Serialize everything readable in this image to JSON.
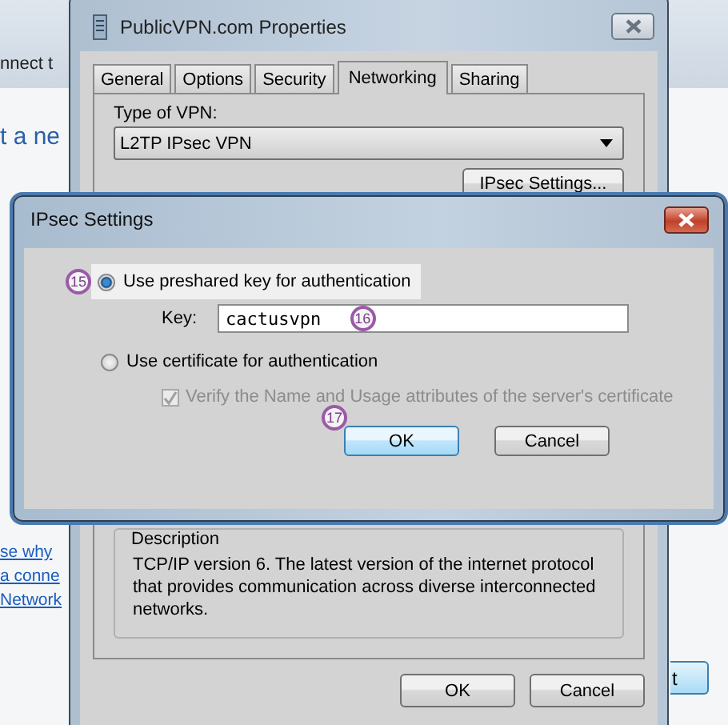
{
  "background_window": {
    "heading_fragment": "nnect t",
    "title_fragment": "t a ne",
    "links": [
      "se why",
      "a conne",
      "Network"
    ],
    "button_fragment": "t"
  },
  "properties_window": {
    "title": "PublicVPN.com Properties",
    "tabs": [
      {
        "label": "General",
        "selected": false
      },
      {
        "label": "Options",
        "selected": false
      },
      {
        "label": "Security",
        "selected": false
      },
      {
        "label": "Networking",
        "selected": true
      },
      {
        "label": "Sharing",
        "selected": false
      }
    ],
    "vpn_type_label": "Type of VPN:",
    "vpn_type_value": "L2TP IPsec VPN",
    "ipsec_button": "IPsec Settings...",
    "description": {
      "legend": "Description",
      "text": "TCP/IP version 6. The latest version of the internet protocol that provides communication across diverse interconnected networks."
    },
    "buttons": [
      "OK",
      "Cancel"
    ]
  },
  "ipsec_dialog": {
    "title": "IPsec Settings",
    "options": [
      {
        "label": "Use preshared key for authentication",
        "selected": true,
        "badge": "15"
      },
      {
        "label": "Use certificate for authentication",
        "selected": false
      }
    ],
    "key_label": "Key:",
    "key_value": "cactusvpn",
    "key_badge": "16",
    "verify": {
      "label": "Verify the Name and Usage attributes of the server's certificate",
      "checked": true,
      "disabled": true
    },
    "ok_badge": "17",
    "buttons": [
      {
        "label": "OK",
        "default": true
      },
      {
        "label": "Cancel",
        "default": false
      }
    ]
  }
}
